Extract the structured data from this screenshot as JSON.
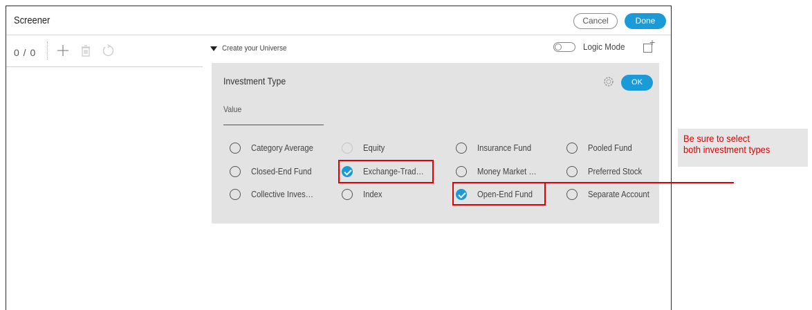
{
  "header": {
    "title": "Screener",
    "cancel_label": "Cancel",
    "done_label": "Done"
  },
  "toolbar": {
    "counter": "0 / 0",
    "icons": [
      "add-icon",
      "delete-icon",
      "refresh-icon"
    ]
  },
  "universe": {
    "toggle_label": "Create your Universe",
    "logic_mode_label": "Logic Mode",
    "logic_mode_on": false
  },
  "investment_type": {
    "title": "Investment Type",
    "ok_label": "OK",
    "value_label": "Value",
    "options": [
      {
        "label": "Category Average",
        "checked": false,
        "disabled": false
      },
      {
        "label": "Closed-End Fund",
        "checked": false,
        "disabled": false
      },
      {
        "label": "Collective Inves…",
        "checked": false,
        "disabled": false
      },
      {
        "label": "Equity",
        "checked": false,
        "disabled": true
      },
      {
        "label": "Exchange-Trad…",
        "checked": true,
        "disabled": false
      },
      {
        "label": "Index",
        "checked": false,
        "disabled": false
      },
      {
        "label": "Insurance Fund",
        "checked": false,
        "disabled": false
      },
      {
        "label": "Money Market …",
        "checked": false,
        "disabled": false
      },
      {
        "label": "Open-End Fund",
        "checked": true,
        "disabled": false
      },
      {
        "label": "Pooled Fund",
        "checked": false,
        "disabled": false
      },
      {
        "label": "Preferred Stock",
        "checked": false,
        "disabled": false
      },
      {
        "label": "Separate Account",
        "checked": false,
        "disabled": false
      }
    ]
  },
  "callout": {
    "text": "Be sure to select\nboth investment types"
  },
  "colors": {
    "accent": "#1a9bd7",
    "highlight": "#e00000",
    "panel": "#e3e3e3"
  }
}
